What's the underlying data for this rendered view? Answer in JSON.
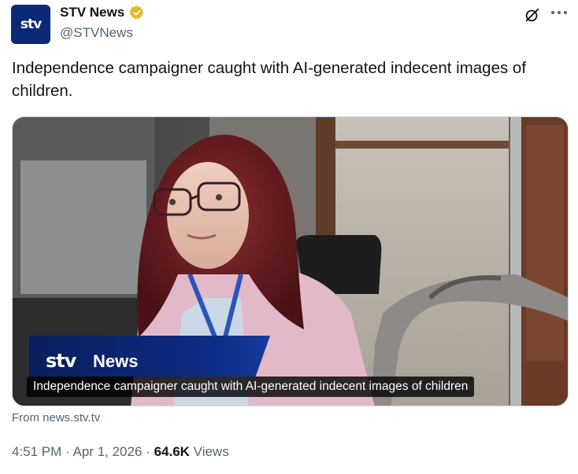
{
  "author": {
    "avatar_text": "stv",
    "display_name": "STV News",
    "handle": "@STVNews",
    "verified": true,
    "verified_color": "#e8b829"
  },
  "icons": {
    "grok": "grok-slash-icon",
    "more": "more-horizontal-icon",
    "verified": "verified-badge-icon"
  },
  "tweet": {
    "text": "Independence campaigner caught with AI-generated indecent images of children."
  },
  "media": {
    "banner_logo": "stv",
    "banner_label": "News",
    "caption": "Independence campaigner caught with AI-generated indecent images of children"
  },
  "link": {
    "source": "From news.stv.tv"
  },
  "meta": {
    "time": "4:51 PM",
    "date": "Apr 1, 2026",
    "separator": "·",
    "views_count": "64.6K",
    "views_label": "Views"
  },
  "colors": {
    "brand_blue": "#0a2a78",
    "text_primary": "#0f1419",
    "text_secondary": "#536471"
  }
}
